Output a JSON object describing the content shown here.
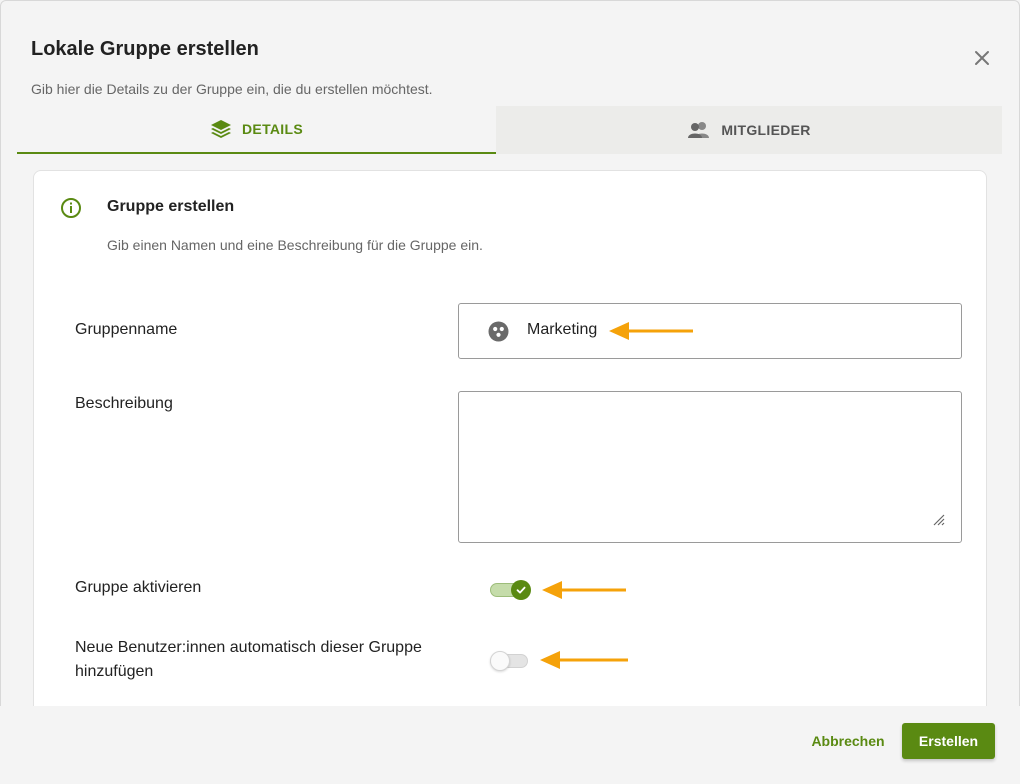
{
  "dialog": {
    "title": "Lokale Gruppe erstellen",
    "subtitle": "Gib hier die Details zu der Gruppe ein, die du erstellen möchtest."
  },
  "tabs": [
    {
      "label": "DETAILS",
      "icon": "layers-icon",
      "active": true
    },
    {
      "label": "MITGLIEDER",
      "icon": "users-icon",
      "active": false
    }
  ],
  "section": {
    "title": "Gruppe erstellen",
    "description": "Gib einen Namen und eine Beschreibung für die Gruppe ein."
  },
  "form": {
    "name_label": "Gruppenname",
    "name_value": "Marketing",
    "description_label": "Beschreibung",
    "description_value": "",
    "activate_label": "Gruppe aktivieren",
    "activate_on": true,
    "autoadd_label_line1": "Neue Benutzer:innen automatisch dieser Gruppe",
    "autoadd_label_line2": "hinzufügen",
    "autoadd_on": false
  },
  "footer": {
    "cancel_label": "Abbrechen",
    "create_label": "Erstellen"
  },
  "colors": {
    "accent": "#5a8a12",
    "annotation_arrow": "#f5a20a"
  }
}
